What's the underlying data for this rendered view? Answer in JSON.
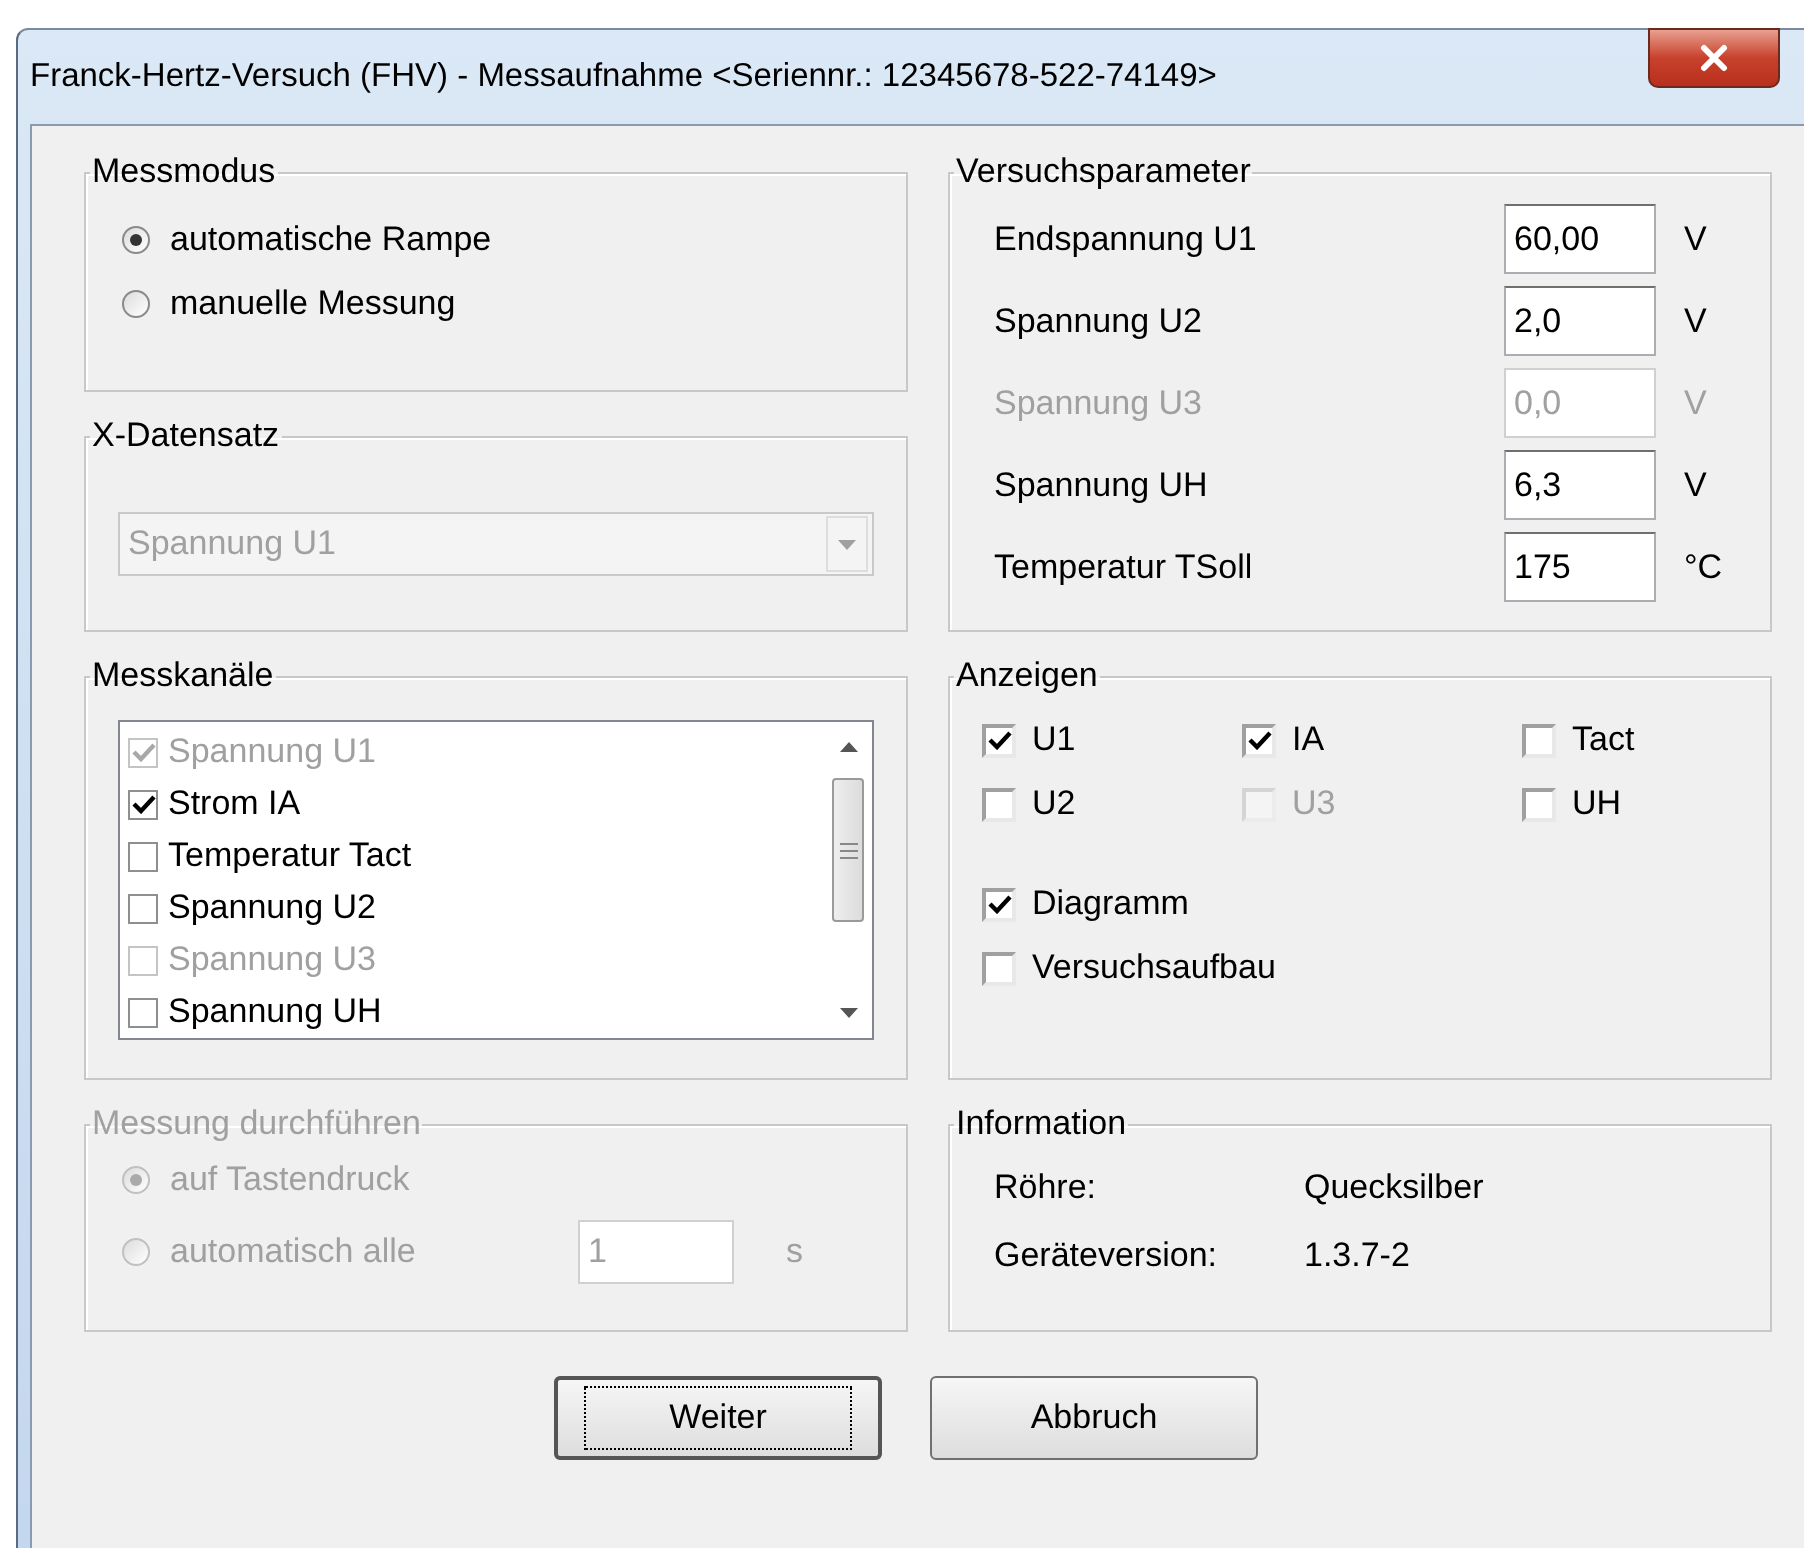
{
  "window": {
    "title": "Franck-Hertz-Versuch (FHV) - Messaufnahme  <Seriennr.: 12345678-522-74149>"
  },
  "messmodus": {
    "title": "Messmodus",
    "options": [
      {
        "label": "automatische Rampe",
        "selected": true,
        "disabled": false
      },
      {
        "label": "manuelle Messung",
        "selected": false,
        "disabled": false
      }
    ]
  },
  "x_datensatz": {
    "title": "X-Datensatz",
    "dropdown": {
      "value": "Spannung U1",
      "disabled": true
    }
  },
  "messkanaele": {
    "title": "Messkanäle",
    "items": [
      {
        "label": "Spannung U1",
        "checked": true,
        "disabled": true
      },
      {
        "label": "Strom IA",
        "checked": true,
        "disabled": false
      },
      {
        "label": "Temperatur Tact",
        "checked": false,
        "disabled": false
      },
      {
        "label": "Spannung U2",
        "checked": false,
        "disabled": false
      },
      {
        "label": "Spannung U3",
        "checked": false,
        "disabled": true
      },
      {
        "label": "Spannung UH",
        "checked": false,
        "disabled": false
      }
    ]
  },
  "messung": {
    "title": "Messung durchführen",
    "disabled": true,
    "options": [
      {
        "label": "auf Tastendruck",
        "selected": true
      },
      {
        "label": "automatisch alle",
        "selected": false
      }
    ],
    "interval": {
      "value": "1",
      "unit": "s"
    }
  },
  "versuchsparameter": {
    "title": "Versuchsparameter",
    "rows": [
      {
        "label": "Endspannung U1",
        "value": "60,00",
        "unit": "V",
        "disabled": false
      },
      {
        "label": "Spannung U2",
        "value": "2,0",
        "unit": "V",
        "disabled": false
      },
      {
        "label": "Spannung U3",
        "value": "0,0",
        "unit": "V",
        "disabled": true
      },
      {
        "label": "Spannung UH",
        "value": "6,3",
        "unit": "V",
        "disabled": false
      },
      {
        "label": "Temperatur TSoll",
        "value": "175",
        "unit": "°C",
        "disabled": false
      }
    ]
  },
  "anzeigen": {
    "title": "Anzeigen",
    "channels": [
      {
        "label": "U1",
        "checked": true,
        "disabled": false
      },
      {
        "label": "IA",
        "checked": true,
        "disabled": false
      },
      {
        "label": "Tact",
        "checked": false,
        "disabled": false
      },
      {
        "label": "U2",
        "checked": false,
        "disabled": false
      },
      {
        "label": "U3",
        "checked": false,
        "disabled": true
      },
      {
        "label": "UH",
        "checked": false,
        "disabled": false
      }
    ],
    "options": [
      {
        "label": "Diagramm",
        "checked": true,
        "disabled": false
      },
      {
        "label": "Versuchsaufbau",
        "checked": false,
        "disabled": false
      }
    ]
  },
  "information": {
    "title": "Information",
    "rows": [
      {
        "label": "Röhre:",
        "value": "Quecksilber"
      },
      {
        "label": "Geräteversion:",
        "value": "1.3.7-2"
      }
    ]
  },
  "buttons": [
    {
      "label": "Weiter",
      "focused": true
    },
    {
      "label": "Abbruch",
      "focused": false
    }
  ]
}
